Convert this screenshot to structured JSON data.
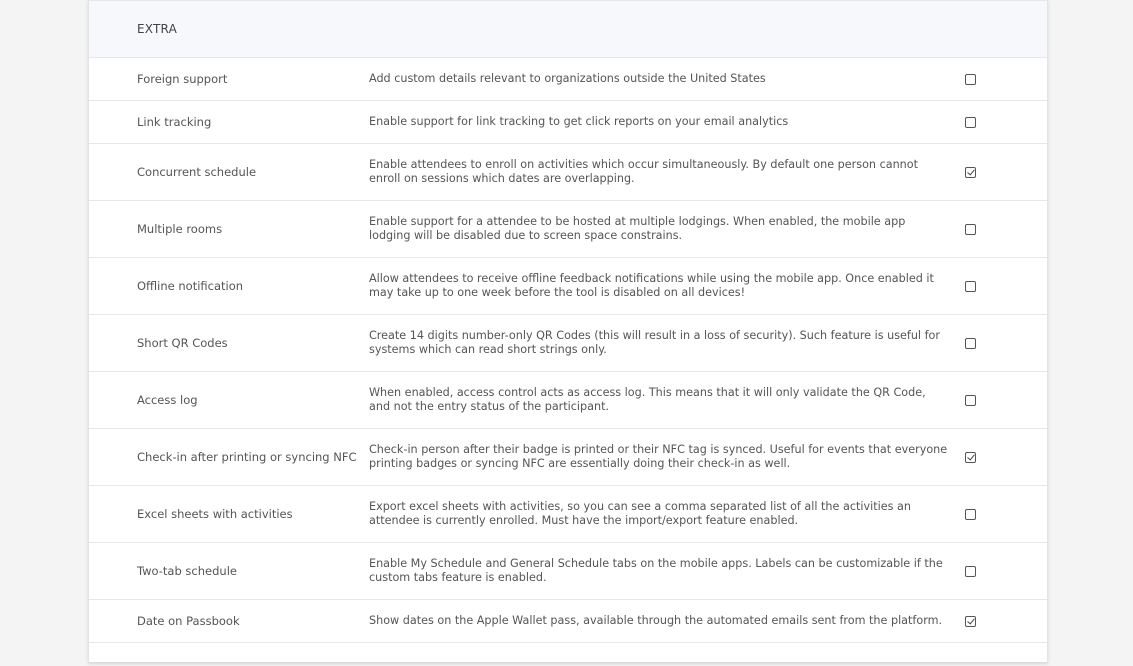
{
  "section": {
    "title": "EXTRA"
  },
  "features": [
    {
      "name": "Foreign support",
      "description": "Add custom details relevant to organizations outside the United States",
      "checked": false
    },
    {
      "name": "Link tracking",
      "description": "Enable support for link tracking to get click reports on your email analytics",
      "checked": false
    },
    {
      "name": "Concurrent schedule",
      "description": "Enable attendees to enroll on activities which occur simultaneously. By default one person cannot enroll on sessions which dates are overlapping.",
      "checked": true
    },
    {
      "name": "Multiple rooms",
      "description": "Enable support for a attendee to be hosted at multiple lodgings. When enabled, the mobile app lodging will be disabled due to screen space constrains.",
      "checked": false
    },
    {
      "name": "Offline notification",
      "description": "Allow attendees to receive offline feedback notifications while using the mobile app. Once enabled it may take up to one week before the tool is disabled on all devices!",
      "checked": false
    },
    {
      "name": "Short QR Codes",
      "description": "Create 14 digits number-only QR Codes (this will result in a loss of security). Such feature is useful for systems which can read short strings only.",
      "checked": false
    },
    {
      "name": "Access log",
      "description": "When enabled, access control acts as access log. This means that it will only validate the QR Code, and not the entry status of the participant.",
      "checked": false
    },
    {
      "name": "Check-in after printing or syncing NFC",
      "description": "Check-in person after their badge is printed or their NFC tag is synced. Useful for events that everyone printing badges or syncing NFC are essentially doing their check-in as well.",
      "checked": true
    },
    {
      "name": "Excel sheets with activities",
      "description": "Export excel sheets with activities, so you can see a comma separated list of all the activities an attendee is currently enrolled. Must have the import/export feature enabled.",
      "checked": false
    },
    {
      "name": "Two-tab schedule",
      "description": "Enable My Schedule and General Schedule tabs on the mobile apps. Labels can be customizable if the custom tabs feature is enabled.",
      "checked": false
    },
    {
      "name": "Date on Passbook",
      "description": "Show dates on the Apple Wallet pass, available through the automated emails sent from the platform.",
      "checked": true
    }
  ]
}
